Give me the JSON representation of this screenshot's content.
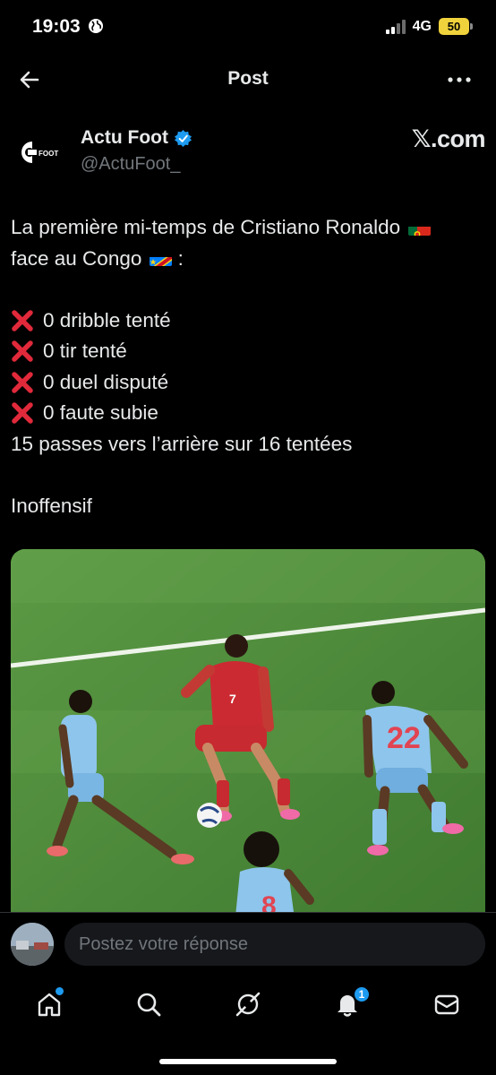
{
  "status_bar": {
    "time": "19:03",
    "network": "4G",
    "battery": "50"
  },
  "header": {
    "title": "Post"
  },
  "author": {
    "name": "Actu Foot",
    "handle": "@ActuFoot_",
    "logo_text": "FOOT",
    "source": "𝕏.com"
  },
  "post": {
    "intro_line1": "La première mi-temps de Cristiano Ronaldo",
    "intro_line2": "face au Congo",
    "intro_line2_suffix": " :",
    "stats": [
      "0 dribble tenté",
      "0 tir tenté",
      "0 duel disputé",
      "0 faute subie"
    ],
    "passes": "15 passes vers l’arrière sur 16 tentées",
    "conclusion": "Inoffensif",
    "flags": [
      "portugal-flag",
      "dr-congo-flag"
    ],
    "stat_icon": "cross-mark-icon"
  },
  "media": {
    "jersey_numbers": [
      "7",
      "22",
      "8"
    ]
  },
  "reply": {
    "placeholder": "Postez votre réponse"
  },
  "bottom_nav": {
    "items": [
      "home-icon",
      "search-icon",
      "grok-icon",
      "notifications-icon",
      "messages-icon"
    ],
    "notification_count": "1"
  },
  "colors": {
    "background": "#000000",
    "text": "#e7e9ea",
    "secondary_text": "#71767b",
    "accent": "#1d9bf0",
    "cross": "#e0293a"
  }
}
